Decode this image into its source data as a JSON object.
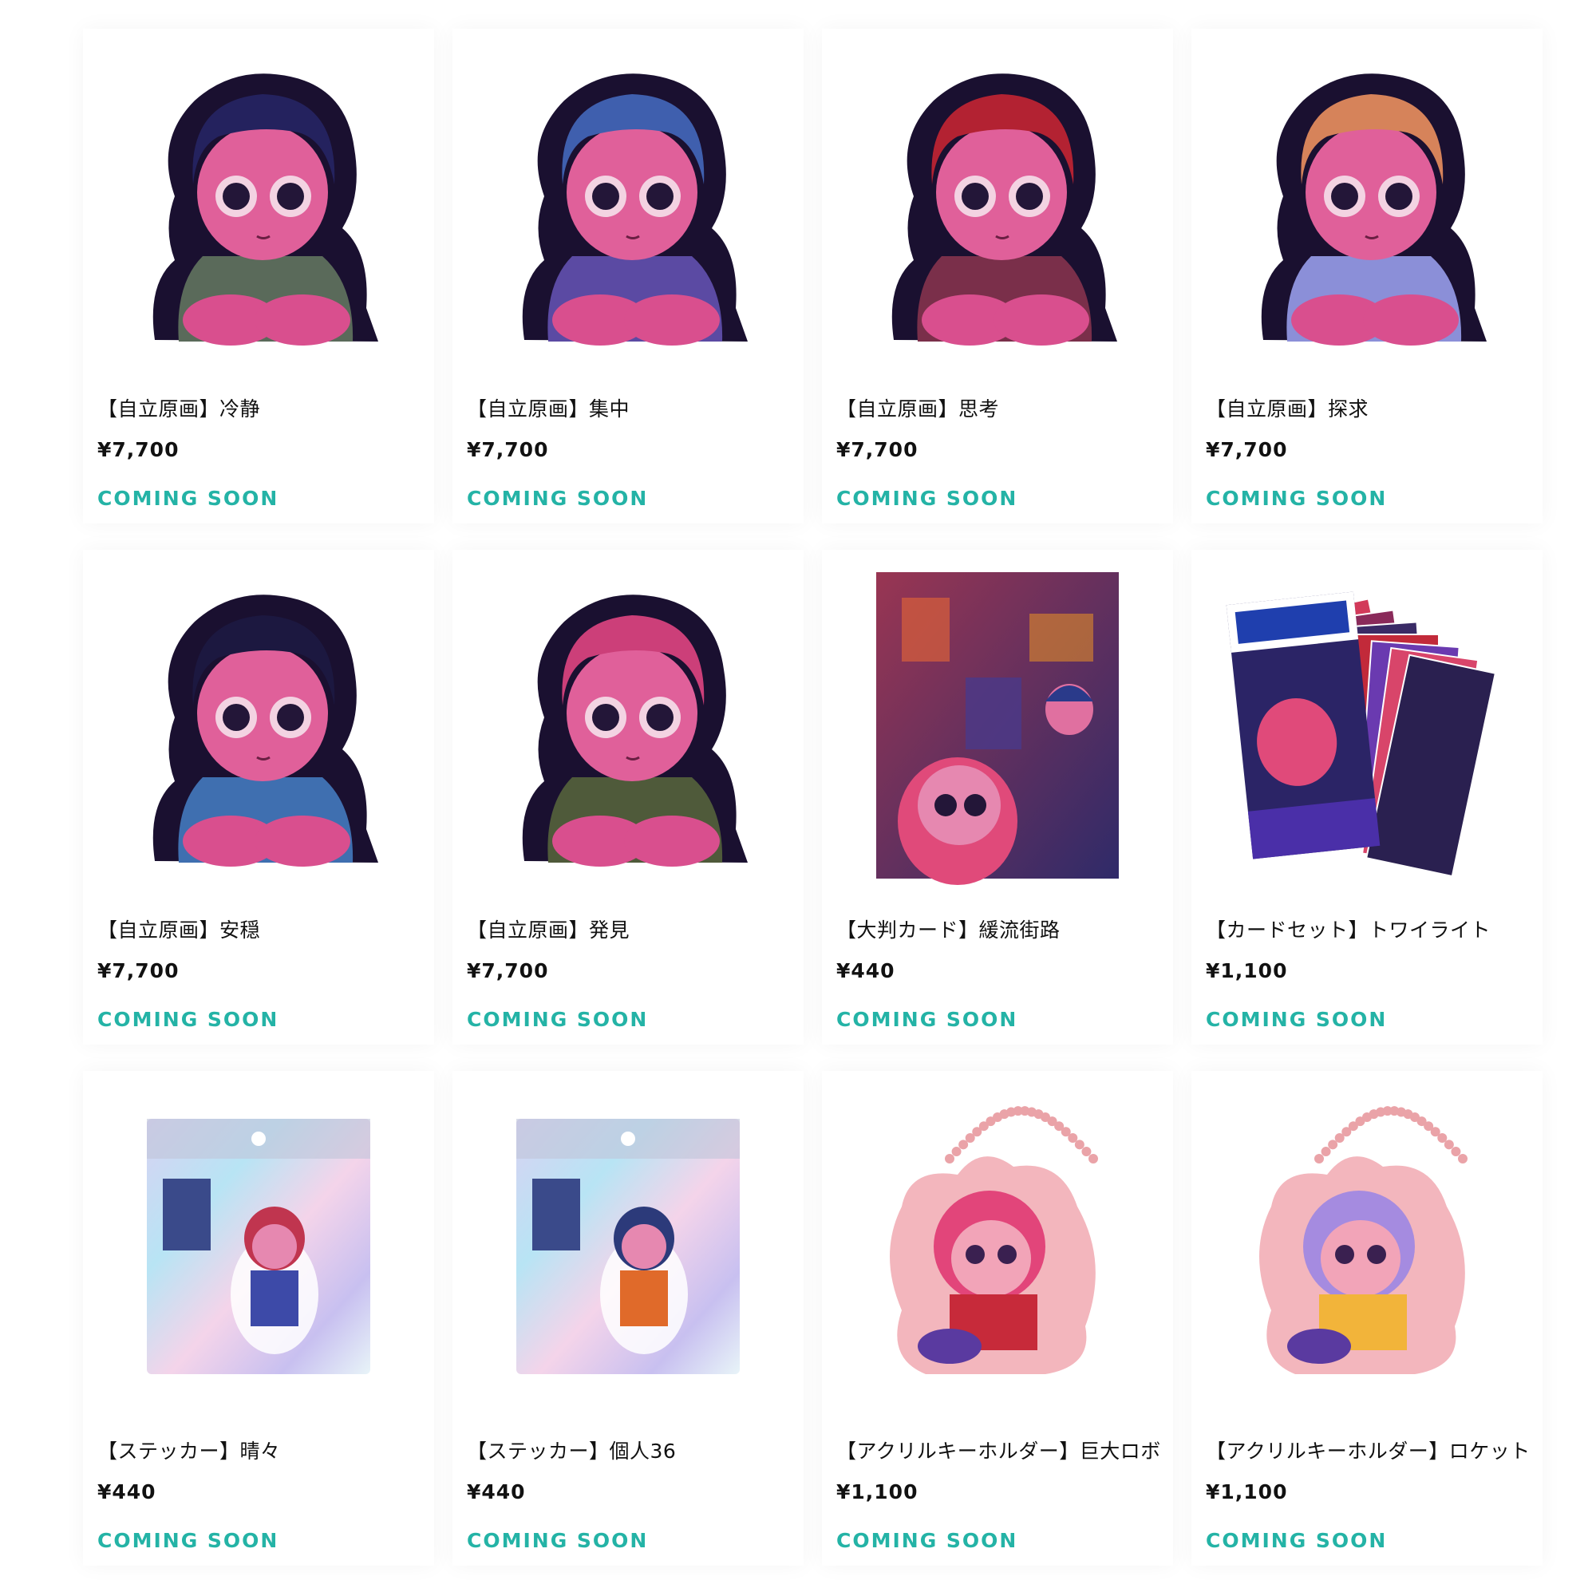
{
  "accent_color": "#24b3a6",
  "products": [
    {
      "name": "【自立原画】冷静",
      "price": "¥7,700",
      "status": "COMING SOON",
      "image_kind": "figure",
      "hair_color": "#24225e",
      "top_color": "#5a6a5a"
    },
    {
      "name": "【自立原画】集中",
      "price": "¥7,700",
      "status": "COMING SOON",
      "image_kind": "figure",
      "hair_color": "#3f5fae",
      "top_color": "#5b4aa3"
    },
    {
      "name": "【自立原画】思考",
      "price": "¥7,700",
      "status": "COMING SOON",
      "image_kind": "figure",
      "hair_color": "#b32232",
      "top_color": "#7a2f4a"
    },
    {
      "name": "【自立原画】探求",
      "price": "¥7,700",
      "status": "COMING SOON",
      "image_kind": "figure",
      "hair_color": "#d6835a",
      "top_color": "#8b8fd8"
    },
    {
      "name": "【自立原画】安穏",
      "price": "¥7,700",
      "status": "COMING SOON",
      "image_kind": "figure",
      "hair_color": "#1c1840",
      "top_color": "#3f6fb0"
    },
    {
      "name": "【自立原画】発見",
      "price": "¥7,700",
      "status": "COMING SOON",
      "image_kind": "figure",
      "hair_color": "#cc3f79",
      "top_color": "#4f5a3a"
    },
    {
      "name": "【大判カード】緩流街路",
      "price": "¥440",
      "status": "COMING SOON",
      "image_kind": "card",
      "hair_color": "#e04a7a",
      "top_color": "#3a2b66"
    },
    {
      "name": "【カードセット】トワイライト",
      "price": "¥1,100",
      "status": "COMING SOON",
      "image_kind": "cardset",
      "hair_color": "#4a2fa8",
      "top_color": "#d23a5a"
    },
    {
      "name": "【ステッカー】晴々",
      "price": "¥440",
      "status": "COMING SOON",
      "image_kind": "sticker",
      "hair_color": "#c0354f",
      "top_color": "#3d4aa8"
    },
    {
      "name": "【ステッカー】個人36",
      "price": "¥440",
      "status": "COMING SOON",
      "image_kind": "sticker",
      "hair_color": "#2c3a7a",
      "top_color": "#e06a2a"
    },
    {
      "name": "【アクリルキーホルダー】巨大ロボ",
      "price": "¥1,100",
      "status": "COMING SOON",
      "image_kind": "keychain",
      "hair_color": "#e2457a",
      "top_color": "#c72a3a"
    },
    {
      "name": "【アクリルキーホルダー】ロケット",
      "price": "¥1,100",
      "status": "COMING SOON",
      "image_kind": "keychain",
      "hair_color": "#a58be0",
      "top_color": "#f2b43a"
    }
  ]
}
